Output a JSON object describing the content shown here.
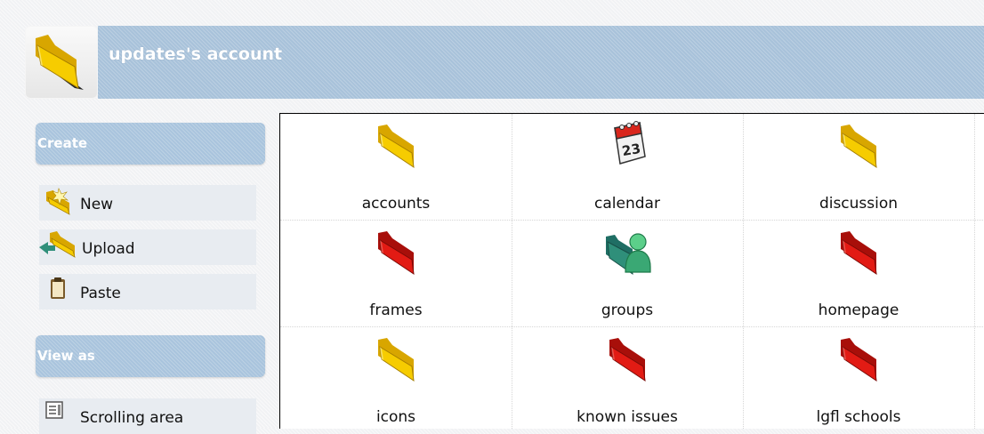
{
  "account": {
    "title": "updates's account",
    "icon": "folder-icon"
  },
  "sidebar": {
    "create": {
      "title": "Create",
      "items": [
        {
          "label": "New",
          "icon": "new-folder-icon"
        },
        {
          "label": "Upload",
          "icon": "upload-folder-icon"
        },
        {
          "label": "Paste",
          "icon": "paste-clipboard-icon"
        }
      ]
    },
    "view_as": {
      "title": "View as",
      "items": [
        {
          "label": "Scrolling area",
          "icon": "scrolling-area-icon"
        }
      ]
    }
  },
  "items": [
    {
      "label": "accounts",
      "icon": "yellow-folder-icon"
    },
    {
      "label": "calendar",
      "icon": "calendar-icon"
    },
    {
      "label": "discussion",
      "icon": "yellow-folder-icon"
    },
    {
      "label": "frames",
      "icon": "red-folder-icon"
    },
    {
      "label": "groups",
      "icon": "group-icon"
    },
    {
      "label": "homepage",
      "icon": "red-folder-icon"
    },
    {
      "label": "icons",
      "icon": "yellow-folder-icon"
    },
    {
      "label": "known issues",
      "icon": "red-folder-icon"
    },
    {
      "label": "lgfl schools",
      "icon": "red-folder-icon"
    }
  ],
  "calendar_icon_day": "23",
  "colors": {
    "header": "#a8c2da",
    "folder_yellow": "#f6cc00",
    "folder_red": "#e21b14",
    "group_green": "#3aa874"
  }
}
